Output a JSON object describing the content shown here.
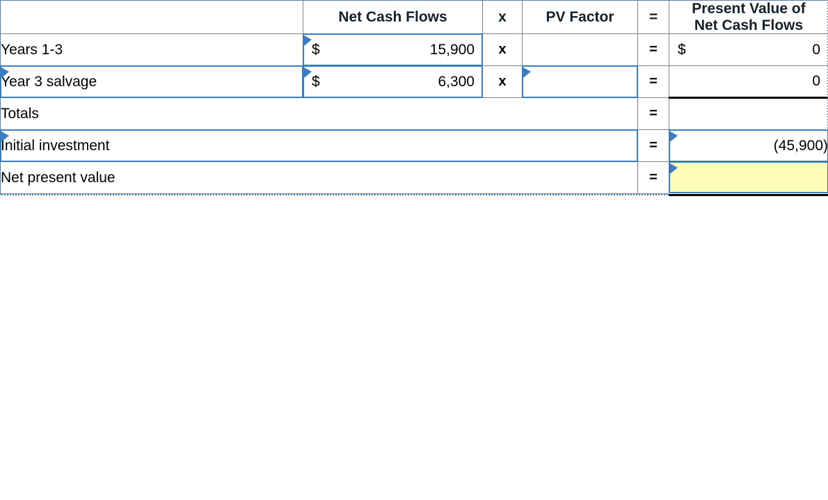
{
  "table": {
    "header": {
      "row_label": "",
      "net_cash_flows": "Net Cash Flows",
      "times": "x",
      "pv_factor": "PV Factor",
      "equals": "=",
      "present_value": "Present Value of\nNet Cash Flows",
      "present_value_line1": "Present Value of",
      "present_value_line2": "Net Cash Flows",
      "header_fill": "#74ACE4"
    },
    "operators": {
      "times": "x",
      "equals": "="
    },
    "currency_symbol": "$",
    "rows": [
      {
        "label": "Years 1-3",
        "ncf_symbol": "$",
        "ncf_value": "15,900",
        "times": "x",
        "pv_factor": "",
        "equals": "=",
        "pv_symbol": "$",
        "pv_value": "0"
      },
      {
        "label": "Year 3 salvage",
        "ncf_symbol": "$",
        "ncf_value": "6,300",
        "times": "x",
        "pv_factor": "",
        "equals": "=",
        "pv_symbol": "",
        "pv_value": "0"
      },
      {
        "label": "Totals",
        "equals": "=",
        "pv_value": ""
      },
      {
        "label": "Initial investment",
        "equals": "=",
        "pv_value": "(45,900)"
      },
      {
        "label": "Net present value",
        "equals": "=",
        "pv_value": ""
      }
    ],
    "colors": {
      "header_blue": "#74ACE4",
      "selection_blue": "#3a7ebf",
      "grid_gray": "#808080",
      "answer_yellow": "#FFFCB8",
      "rule_black": "#000000"
    },
    "markers": {
      "input_flag": "input-marker-triangle"
    }
  }
}
